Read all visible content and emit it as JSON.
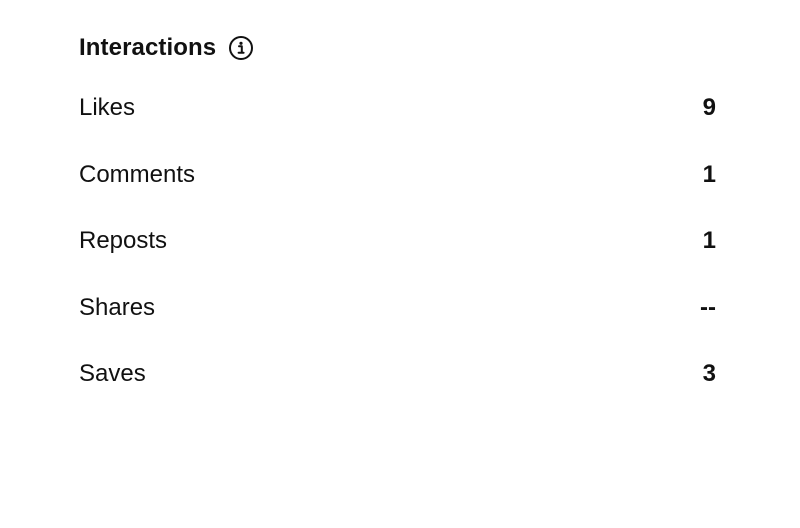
{
  "interactions": {
    "title": "Interactions",
    "info_icon": "info-circle-icon",
    "rows": [
      {
        "label": "Likes",
        "value": "9"
      },
      {
        "label": "Comments",
        "value": "1"
      },
      {
        "label": "Reposts",
        "value": "1"
      },
      {
        "label": "Shares",
        "value": "--"
      },
      {
        "label": "Saves",
        "value": "3"
      }
    ]
  }
}
